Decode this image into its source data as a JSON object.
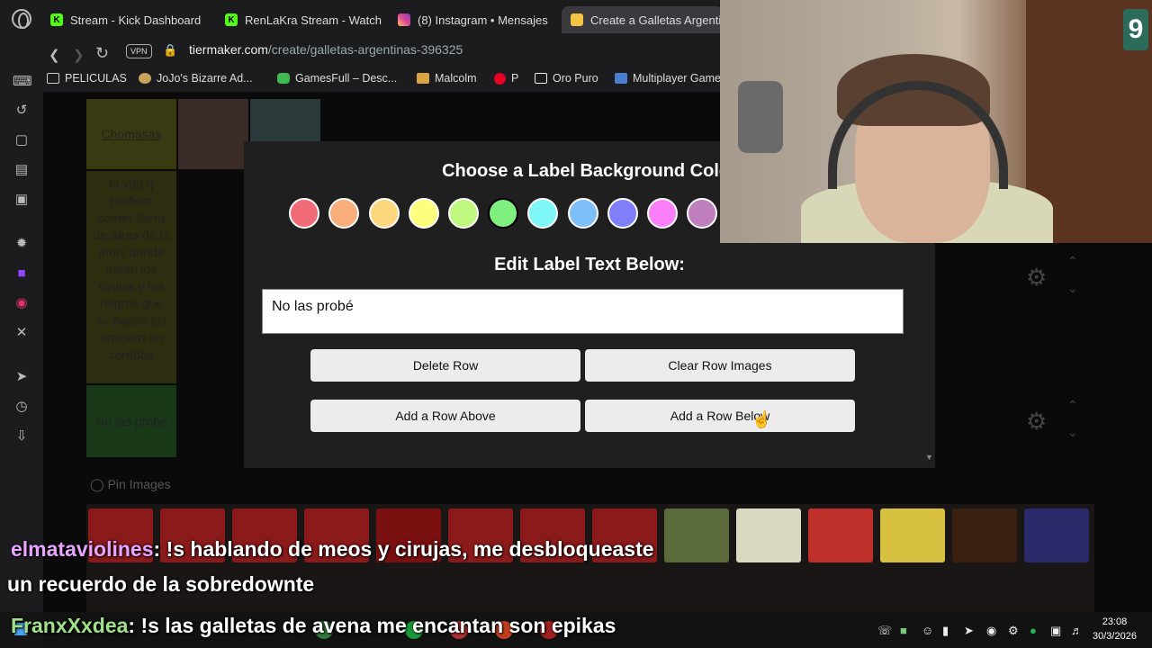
{
  "browser": {
    "tabs": [
      {
        "label": "Stream - Kick Dashboard",
        "icon": "kick-icon"
      },
      {
        "label": "RenLaKra Stream - Watch",
        "icon": "kick-icon"
      },
      {
        "label": "(8) Instagram • Mensajes",
        "icon": "instagram-icon"
      },
      {
        "label": "Create a Galletas Argentin",
        "icon": "tiermaker-icon"
      }
    ],
    "vpn_label": "VPN",
    "url_host": "tiermaker.com",
    "url_path": "/create/galletas-argentinas-396325",
    "bookmarks": [
      {
        "label": "PELICULAS",
        "icon": "folder-icon"
      },
      {
        "label": "JoJo's Bizarre Ad...",
        "icon": "jojo-icon"
      },
      {
        "label": "GamesFull – Desc...",
        "icon": "gamepad-icon"
      },
      {
        "label": "Malcolm",
        "icon": "malcolm-icon"
      },
      {
        "label": "P",
        "icon": "pinterest-icon"
      },
      {
        "label": "Oro Puro",
        "icon": "notion-icon"
      },
      {
        "label": "Multiplayer Game",
        "icon": "multiplayer-icon"
      }
    ]
  },
  "page": {
    "tier_labels": [
      "Chomasas",
      "la vdd q prefiero comer tierra de atras de la muni donde mean los cirujas y los negros que se hacen los eminem en cordoba",
      "No las probé"
    ],
    "pin_images": "Pin Images"
  },
  "modal": {
    "title": "Choose a Label Background Color",
    "edit_title": "Edit Label Text Below:",
    "label_text": "No las probé",
    "colors": [
      "#f26b79",
      "#f7ae7a",
      "#fbd77d",
      "#fdfd7e",
      "#bff77f",
      "#7ff07f",
      "#7ff7f8",
      "#7fbff9",
      "#7f7ffa",
      "#fb7ffa",
      "#bf7fbf"
    ],
    "selected_color": "#7ff07f",
    "buttons": {
      "delete_row": "Delete Row",
      "clear_row_images": "Clear Row Images",
      "add_row_above": "Add a Row Above",
      "add_row_below": "Add a Row Below"
    }
  },
  "webcam": {
    "badge": "9"
  },
  "chat": [
    {
      "user": "elmataviolines",
      "message": ": !s hablando de meos y cirujas, me desbloqueaste",
      "continuation": "un recuerdo de la sobredownte"
    },
    {
      "user": "FranxXxdea",
      "message": ": !s las galletas de avena me encantan son epikas"
    }
  ],
  "taskbar": {
    "time": "23:08",
    "date": "30/3/2026"
  }
}
